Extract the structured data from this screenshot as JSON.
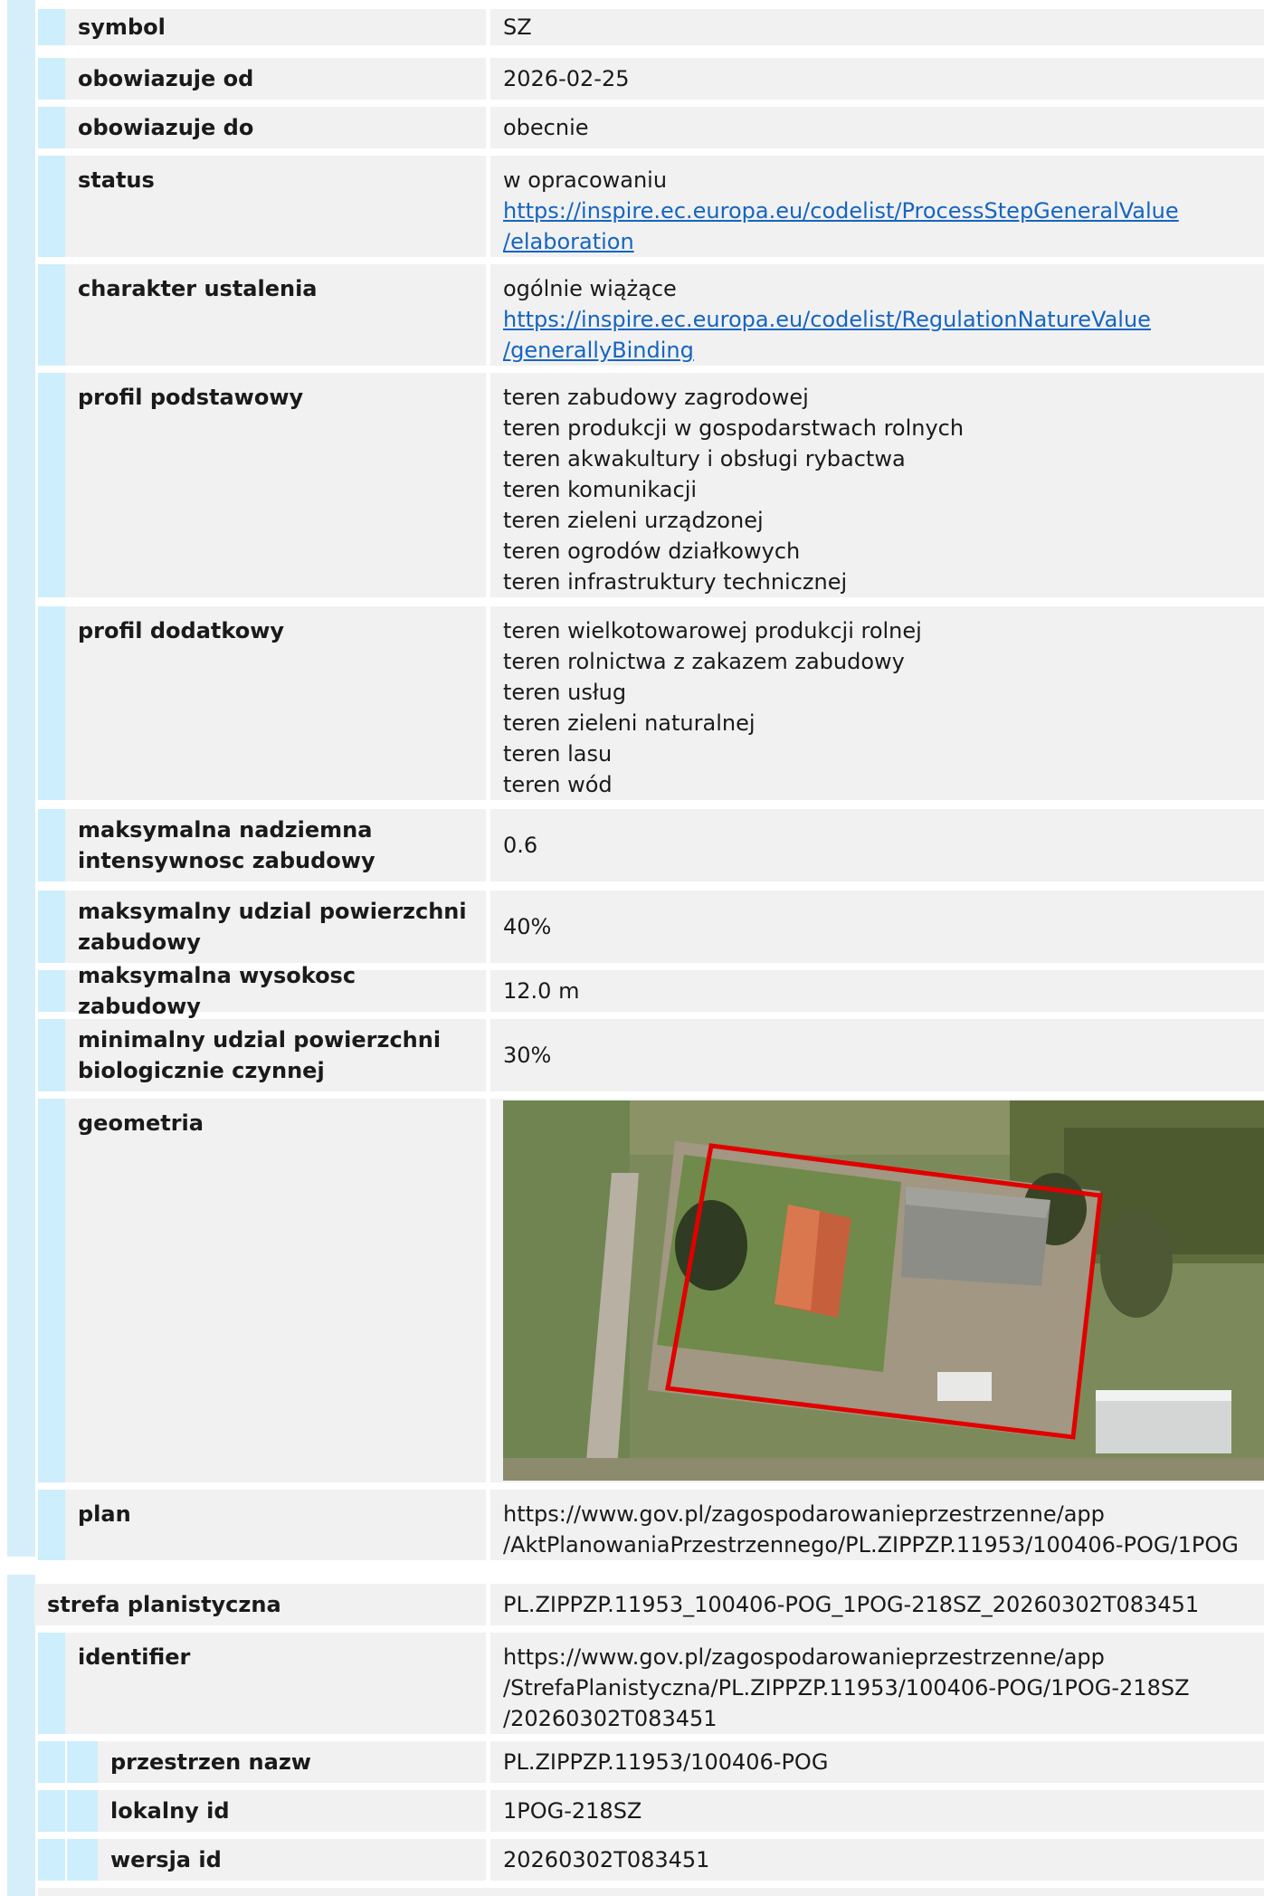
{
  "attributes": {
    "symbol": {
      "label": "symbol",
      "value": "SZ"
    },
    "valid_from": {
      "label": "obowiazuje od",
      "value": "2026-02-25"
    },
    "valid_to": {
      "label": "obowiazuje do",
      "value": "obecnie"
    },
    "status": {
      "label": "status",
      "value": "w opracowaniu",
      "link_line1": "https://inspire.ec.europa.eu/codelist/ProcessStepGeneralValue",
      "link_line2": "/elaboration"
    },
    "regulation": {
      "label": "charakter ustalenia",
      "value": "ogólnie wiążące",
      "link_line1": "https://inspire.ec.europa.eu/codelist/RegulationNatureValue",
      "link_line2": "/generallyBinding"
    },
    "basic_profile": {
      "label": "profil podstawowy",
      "items": [
        "teren zabudowy zagrodowej",
        "teren produkcji w gospodarstwach rolnych",
        "teren akwakultury i obsługi rybactwa",
        "teren komunikacji",
        "teren zieleni urządzonej",
        "teren ogrodów działkowych",
        "teren infrastruktury technicznej"
      ]
    },
    "additional_profile": {
      "label": "profil dodatkowy",
      "items": [
        "teren wielkotowarowej produkcji rolnej",
        "teren rolnictwa z zakazem zabudowy",
        "teren usług",
        "teren zieleni naturalnej",
        "teren lasu",
        "teren wód"
      ]
    },
    "max_intensity": {
      "label_line1": "maksymalna nadziemna",
      "label_line2": "intensywnosc zabudowy",
      "value": "0.6"
    },
    "max_coverage": {
      "label_line1": "maksymalny udzial powierzchni",
      "label_line2": "zabudowy",
      "value": "40%"
    },
    "max_height": {
      "label": "maksymalna wysokosc zabudowy",
      "value": "12.0 m"
    },
    "min_bio": {
      "label_line1": "minimalny udzial powierzchni",
      "label_line2": "biologicznie czynnej",
      "value": "30%"
    },
    "geometry": {
      "label": "geometria"
    },
    "plan": {
      "label": "plan",
      "line1": "https://www.gov.pl/zagospodarowanieprzestrzenne/app",
      "line2": "/AktPlanowaniaPrzestrzennego/PL.ZIPPZP.11953/100406-POG/1POG"
    }
  },
  "zone": {
    "label": "strefa planistyczna",
    "value": "PL.ZIPPZP.11953_100406-POG_1POG-218SZ_20260302T083451",
    "identifier": {
      "label": "identifier",
      "line1": "https://www.gov.pl/zagospodarowanieprzestrzenne/app",
      "line2": "/StrefaPlanistyczna/PL.ZIPPZP.11953/100406-POG/1POG-218SZ",
      "line3": "/20260302T083451"
    },
    "namespace": {
      "label": "przestrzen nazw",
      "value": "PL.ZIPPZP.11953/100406-POG"
    },
    "local_id": {
      "label": "lokalny id",
      "value": "1POG-218SZ"
    },
    "version_id": {
      "label": "wersja id",
      "value": "20260302T083451"
    }
  },
  "colors": {
    "label_bg": "#f1f1f1",
    "bar": "#cdeefc",
    "link": "#1565c0",
    "parcel_outline": "#e00000"
  }
}
